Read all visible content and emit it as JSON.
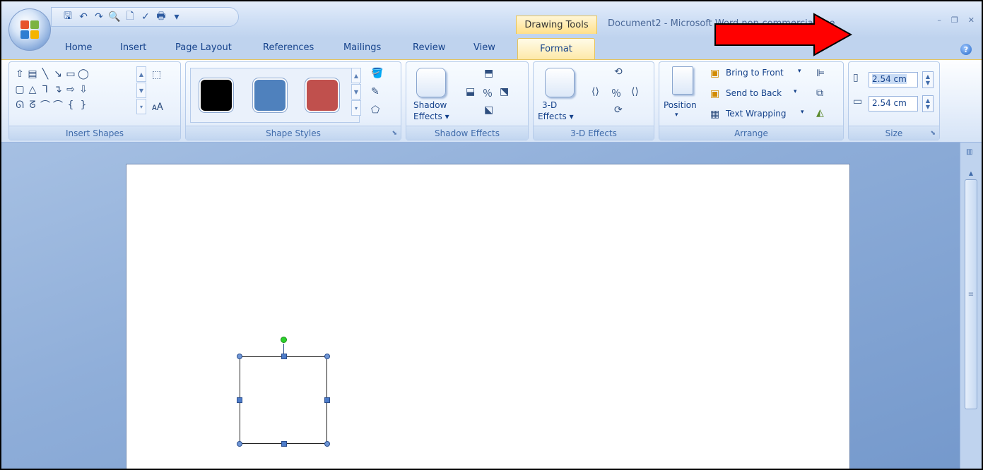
{
  "titlebar": {
    "context_tab": "Drawing Tools",
    "window_title": "Document2 - Microsoft Word non-commercial use",
    "controls": [
      "–",
      "❐",
      "✕"
    ]
  },
  "qat": {
    "icons": [
      "save-icon",
      "undo-icon",
      "redo-icon",
      "print-preview-icon",
      "new-document-icon",
      "spelling-icon",
      "quick-print-icon",
      "customize-qat-icon"
    ],
    "glyphs": [
      "🖫",
      "↶",
      "↷",
      "🔍",
      "🗋",
      "✓",
      "🖶",
      "▾"
    ]
  },
  "tabs": [
    {
      "label": "Home"
    },
    {
      "label": "Insert"
    },
    {
      "label": "Page Layout"
    },
    {
      "label": "References"
    },
    {
      "label": "Mailings"
    },
    {
      "label": "Review"
    },
    {
      "label": "View"
    },
    {
      "label": "Format",
      "active": true
    }
  ],
  "ribbon": {
    "insert_shapes": {
      "label": "Insert Shapes",
      "shapes": [
        "⇧",
        "▤",
        "╲",
        "↘",
        "▭",
        "◯",
        "▢",
        "△",
        "⅂",
        "↴",
        "⇨",
        "⇩",
        "ᘏ",
        "ᘔ",
        "⌒",
        "⌒",
        "{",
        "}"
      ]
    },
    "shape_styles": {
      "label": "Shape Styles",
      "swatches": [
        "#000000",
        "#4f81bd",
        "#c0504d"
      ]
    },
    "shadow_effects": {
      "label": "Shadow Effects",
      "button_line1": "Shadow",
      "button_line2": "Effects ▾"
    },
    "three_d_effects": {
      "label": "3-D Effects",
      "button_line1": "3-D",
      "button_line2": "Effects ▾"
    },
    "arrange": {
      "label": "Arrange",
      "position_label": "Position",
      "bring_to_front": "Bring to Front",
      "send_to_back": "Send to Back",
      "text_wrapping": "Text Wrapping"
    },
    "size": {
      "label": "Size",
      "height_value": "2.54 cm",
      "width_value": "2.54 cm"
    }
  },
  "colors": {
    "accent": "#15428b",
    "ribbon_bg": "#dbe7f7",
    "context_tab": "#ffe08a",
    "arrow": "#ff0000",
    "rotation_handle": "#2cd12c"
  }
}
